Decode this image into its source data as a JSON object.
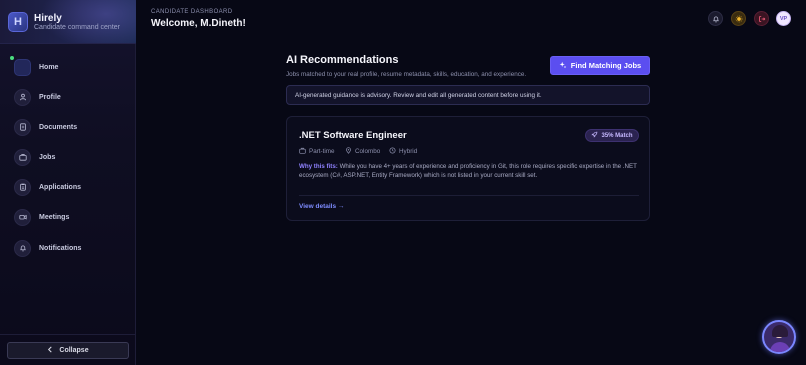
{
  "brand": {
    "name": "Hirely",
    "subtitle": "Candidate command center",
    "logo_letter": "H"
  },
  "sidebar": {
    "items": [
      {
        "label": "Home",
        "icon": "home-icon"
      },
      {
        "label": "Profile",
        "icon": "user-icon"
      },
      {
        "label": "Documents",
        "icon": "document-icon"
      },
      {
        "label": "Jobs",
        "icon": "briefcase-icon"
      },
      {
        "label": "Applications",
        "icon": "clipboard-icon"
      },
      {
        "label": "Meetings",
        "icon": "video-icon"
      },
      {
        "label": "Notifications",
        "icon": "bell-icon"
      }
    ],
    "collapse_label": "Collapse"
  },
  "header": {
    "kicker": "CANDIDATE DASHBOARD",
    "title": "Welcome, M.Dineth!",
    "avatar_initials": "VP"
  },
  "main": {
    "title": "AI Recommendations",
    "subtitle": "Jobs matched to your real profile, resume metadata, skills, education, and experience.",
    "find_button": "Find Matching Jobs",
    "advisory": "AI-generated guidance is advisory. Review and edit all generated content before using it."
  },
  "job": {
    "title": ".NET Software Engineer",
    "match": "35% Match",
    "type": "Part-time",
    "location": "Colombo",
    "mode": "Hybrid",
    "why_label": "Why this fits:",
    "why_text": "While you have 4+ years of experience and proficiency in Git, this role requires specific expertise in the .NET ecosystem (C#, ASP.NET, Entity Framework) which is not listed in your current skill set.",
    "view_details": "View details →"
  },
  "colors": {
    "accent": "#5b4ef0",
    "background": "#070815",
    "online": "#4ade80"
  }
}
